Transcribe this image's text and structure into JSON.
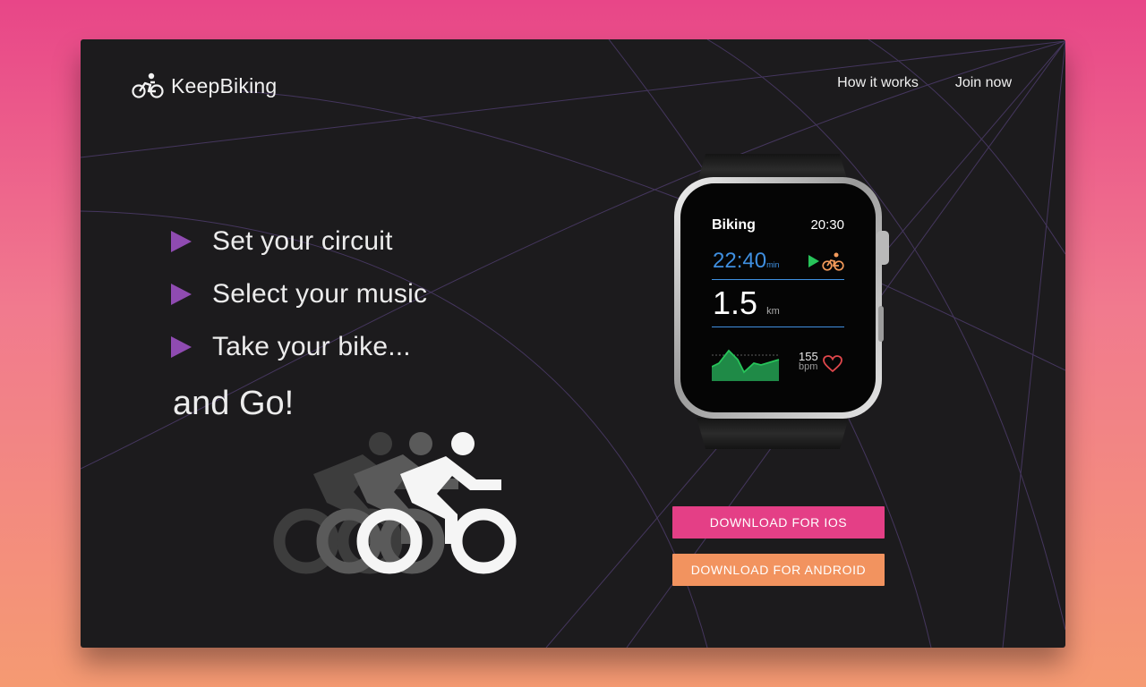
{
  "brand": {
    "name": "KeepBiking",
    "logo_icon": "bike-icon"
  },
  "nav": {
    "how_it_works": "How it works",
    "join_now": "Join now"
  },
  "steps": [
    {
      "label": "Set your circuit",
      "icon": "play-triangle-icon"
    },
    {
      "label": "Select your music",
      "icon": "play-triangle-icon"
    },
    {
      "label": "Take your bike...",
      "icon": "play-triangle-icon"
    }
  ],
  "tagline": "and Go!",
  "watch": {
    "title": "Biking",
    "clock": "20:30",
    "duration": "22:40",
    "duration_unit": "min",
    "distance": "1.5",
    "distance_unit": "km",
    "heart_rate": "155",
    "heart_rate_unit": "bpm"
  },
  "buttons": {
    "ios": "DOWNLOAD FOR IOS",
    "android": "DOWNLOAD FOR ANDROID"
  },
  "colors": {
    "background_top": "#e84688",
    "background_bottom": "#f59a72",
    "panel": "#1c1b1d",
    "accent_purple": "#8f4bb1",
    "ios_button": "#e43f86",
    "android_button": "#f2935f",
    "watch_blue": "#3f8fe0",
    "watch_green": "#27c45a",
    "watch_orange": "#f39a5a",
    "heart_red": "#e0474c"
  }
}
